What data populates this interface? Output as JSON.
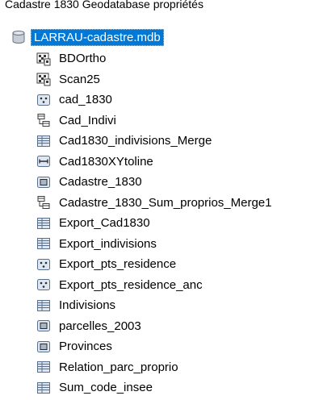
{
  "header_title": "Cadastre 1830 Geodatabase propriétés",
  "geodatabase": {
    "name": "LARRAU-cadastre.mdb",
    "icon": "geodatabase-icon"
  },
  "items": [
    {
      "label": "BDOrtho",
      "icon": "raster-dataset-icon"
    },
    {
      "label": "Scan25",
      "icon": "raster-dataset-icon"
    },
    {
      "label": "cad_1830",
      "icon": "point-feature-class-icon"
    },
    {
      "label": "Cad_Indivi",
      "icon": "relationship-class-icon"
    },
    {
      "label": "Cad1830_indivisions_Merge",
      "icon": "table-icon"
    },
    {
      "label": "Cad1830XYtoline",
      "icon": "line-feature-class-icon"
    },
    {
      "label": "Cadastre_1830",
      "icon": "polygon-feature-class-icon"
    },
    {
      "label": "Cadastre_1830_Sum_proprios_Merge1",
      "icon": "relationship-class-icon"
    },
    {
      "label": "Export_Cad1830",
      "icon": "table-icon"
    },
    {
      "label": "Export_indivisions",
      "icon": "table-icon"
    },
    {
      "label": "Export_pts_residence",
      "icon": "point-feature-class-icon"
    },
    {
      "label": "Export_pts_residence_anc",
      "icon": "point-feature-class-icon"
    },
    {
      "label": "Indivisions",
      "icon": "table-icon"
    },
    {
      "label": "parcelles_2003",
      "icon": "polygon-feature-class-icon"
    },
    {
      "label": "Provinces",
      "icon": "polygon-feature-class-icon"
    },
    {
      "label": "Relation_parc_proprio",
      "icon": "table-icon"
    },
    {
      "label": "Sum_code_insee",
      "icon": "table-icon"
    }
  ],
  "colors": {
    "selection": "#0078d7",
    "icon_border": "#5a6f8c",
    "icon_fill": "#dde7f3"
  }
}
